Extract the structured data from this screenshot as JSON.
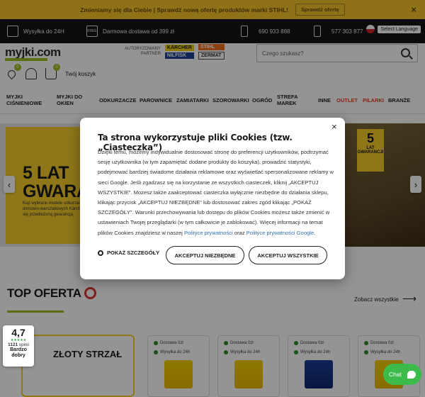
{
  "promo": {
    "text": "Zmieniamy się dla Ciebie | Sprawdź nową ofertę produktów marki STIHL!",
    "button": "Sprawdź ofertę",
    "close": "×"
  },
  "infobar": {
    "shipping_time": "Wysyłka do 24H",
    "free_badge": "FREE",
    "free_shipping": "Darmowa dostawa od 399 zł",
    "phone1": "690 933 888",
    "phone2": "577 303 877",
    "lang_select": "Select Language"
  },
  "header": {
    "logo": "myjki.com",
    "partner_label_1": "AUTORYZOWANY",
    "partner_label_2": "PARTNER",
    "brands": [
      "KÄRCHER",
      "STIHL",
      "NILFISK",
      "ZERMAT"
    ],
    "search_placeholder": "Czego szukasz?",
    "wishlist_count": "0",
    "cart_count": "0",
    "cart_label": "Twój koszyk"
  },
  "nav": {
    "items": [
      "MYJKI CIŚNIENIOWE",
      "MYJKI DO OKIEN",
      "ODKURZACZE",
      "PAROWNICE",
      "ZAMIATARKI",
      "SZOROWARKI",
      "OGRÓD",
      "STREFA MAREK",
      "INNE",
      "OUTLET",
      "PILARKI",
      "BRANŻE"
    ]
  },
  "hero": {
    "title1": "5 LAT",
    "title2": "GWARA",
    "small": "Kup wybrane modele odkurzaczy domowo-warsztatowych Kärcher i ciesz się przedłużoną gwarancją",
    "badge_big": "5",
    "badge_lat": "LAT",
    "badge_sub": "GWARANCJI",
    "prev": "‹",
    "next": "›"
  },
  "section": {
    "title": "TOP OFERTA",
    "see_all": "Zobacz wszystkie",
    "arrow": "⟶",
    "zloty": "ZŁOTY STRZAŁ"
  },
  "products": [
    {
      "tag1": "Dostawa 0zł",
      "tag2": "Wysyłka do 24h"
    },
    {
      "tag1": "Dostawa 0zł",
      "tag2": "Wysyłka do 24h"
    },
    {
      "tag1": "Dostawa 0zł",
      "tag2": "Wysyłka do 24h"
    },
    {
      "tag1": "Dostawa 0zł",
      "tag2": "Wysyłka do 24h"
    }
  ],
  "rating": {
    "score": "4,7",
    "stars": "★★★★★",
    "count": "1121",
    "count_label": "opinii",
    "label": "Bardzo dobry"
  },
  "chat": {
    "label": "Chat"
  },
  "cookie": {
    "title": "Ta strona wykorzystuje pliki Cookies (tzw. „Ciasteczka”)",
    "close": "×",
    "body_1": "Dzięki temu, możemy indywidualnie dostosować stronę do preferencji użytkowników, podtrzymać sesję użytkownika (w tym zapamiętać dodane produkty do koszyka), prowadzić statystyki, podejmować bardziej świadome działania reklamowe oraz wyświetlać spersonalizowane reklamy w sieci Google. Jeśli zgadzasz się na korzystanie ze wszystkich ciasteczek, kliknij „AKCEPTUJ WSZYSTKIE”. Możesz także zaakceptować ciasteczka wyłącznie niezbędne do działania sklepu, klikając przycisk „AKCEPTUJ NIEZBĘDNE” lub dostosować zakres zgód klikając „POKAŻ SZCZEGÓŁY”. Warunki przechowywania lub dostępu do plików Cookies możesz także zmienić w ustawieniach Twojej przeglądarki (w tym całkowicie je zablokować). Więcej informacji na temat plików Cookies znajdziesz w naszej ",
    "link_1": "Polityce prywatności",
    "body_2": " oraz ",
    "link_2": "Polityce prywatności Google",
    "body_3": ".",
    "details": "POKAŻ SZCZEGÓŁY",
    "accept_necessary": "AKCEPTUJ NIEZBĘDNE",
    "accept_all": "AKCEPTUJ WSZYSTKIE"
  }
}
